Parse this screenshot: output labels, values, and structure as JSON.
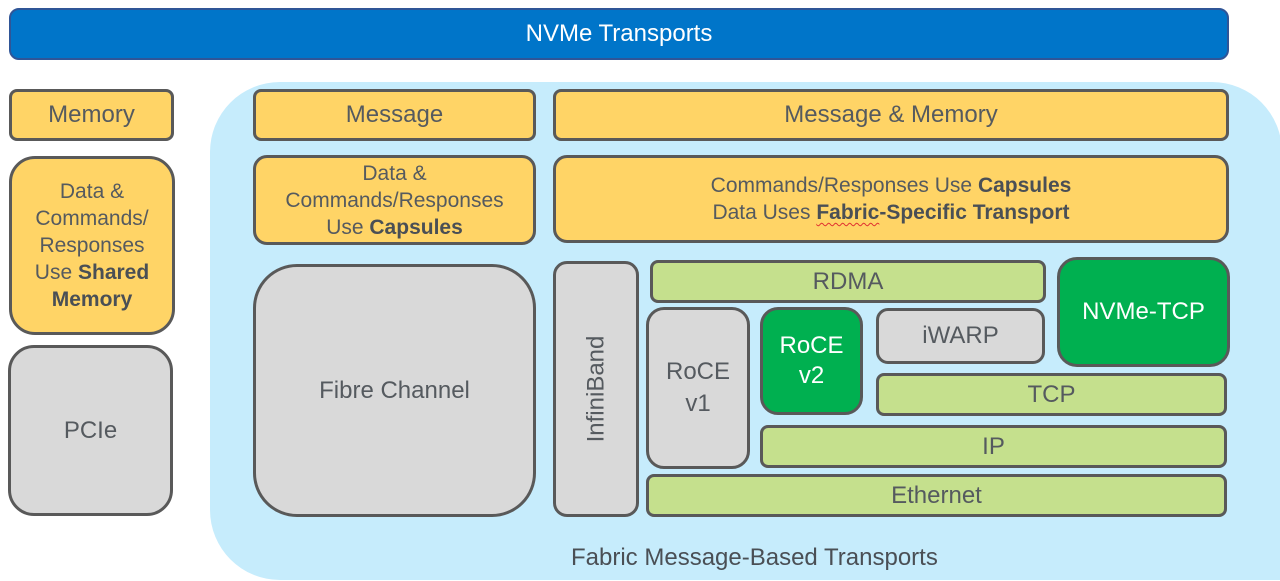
{
  "title": "NVMe Transports",
  "memory_column": {
    "header": "Memory",
    "description": {
      "line1": "Data &",
      "line2": "Commands/",
      "line3": "Responses",
      "line4_plain": "Use ",
      "line4_bold": "Shared",
      "line5_bold": "Memory"
    },
    "transport": "PCIe"
  },
  "fabric": {
    "label": "Fabric Message-Based Transports",
    "message_column": {
      "header": "Message",
      "description": {
        "line1": "Data &",
        "line2": "Commands/Responses",
        "line3_plain": "Use ",
        "line3_bold": "Capsules"
      },
      "transport": "Fibre Channel"
    },
    "message_memory_column": {
      "header": "Message & Memory",
      "description": {
        "line1_plain": "Commands/Responses Use ",
        "line1_bold": "Capsules",
        "line2_plain": "Data Uses ",
        "line2_bold_a": "Fabric",
        "line2_bold_b": "-Specific Transport"
      },
      "stack": {
        "infiniband": "InfiniBand",
        "rdma": "RDMA",
        "roce_v1": {
          "line1": "RoCE",
          "line2": "v1"
        },
        "roce_v2": {
          "line1": "RoCE",
          "line2": "v2"
        },
        "iwarp": "iWARP",
        "nvme_tcp": "NVMe-TCP",
        "tcp": "TCP",
        "ip": "IP",
        "ethernet": "Ethernet"
      }
    }
  },
  "colors": {
    "title_blue": "#0075c9",
    "fabric_background": "#c6ecfc",
    "layer_yellow": "#ffd466",
    "transport_gray": "#d9d9d9",
    "protocol_light_green": "#c5e08d",
    "highlight_green": "#00b050"
  }
}
